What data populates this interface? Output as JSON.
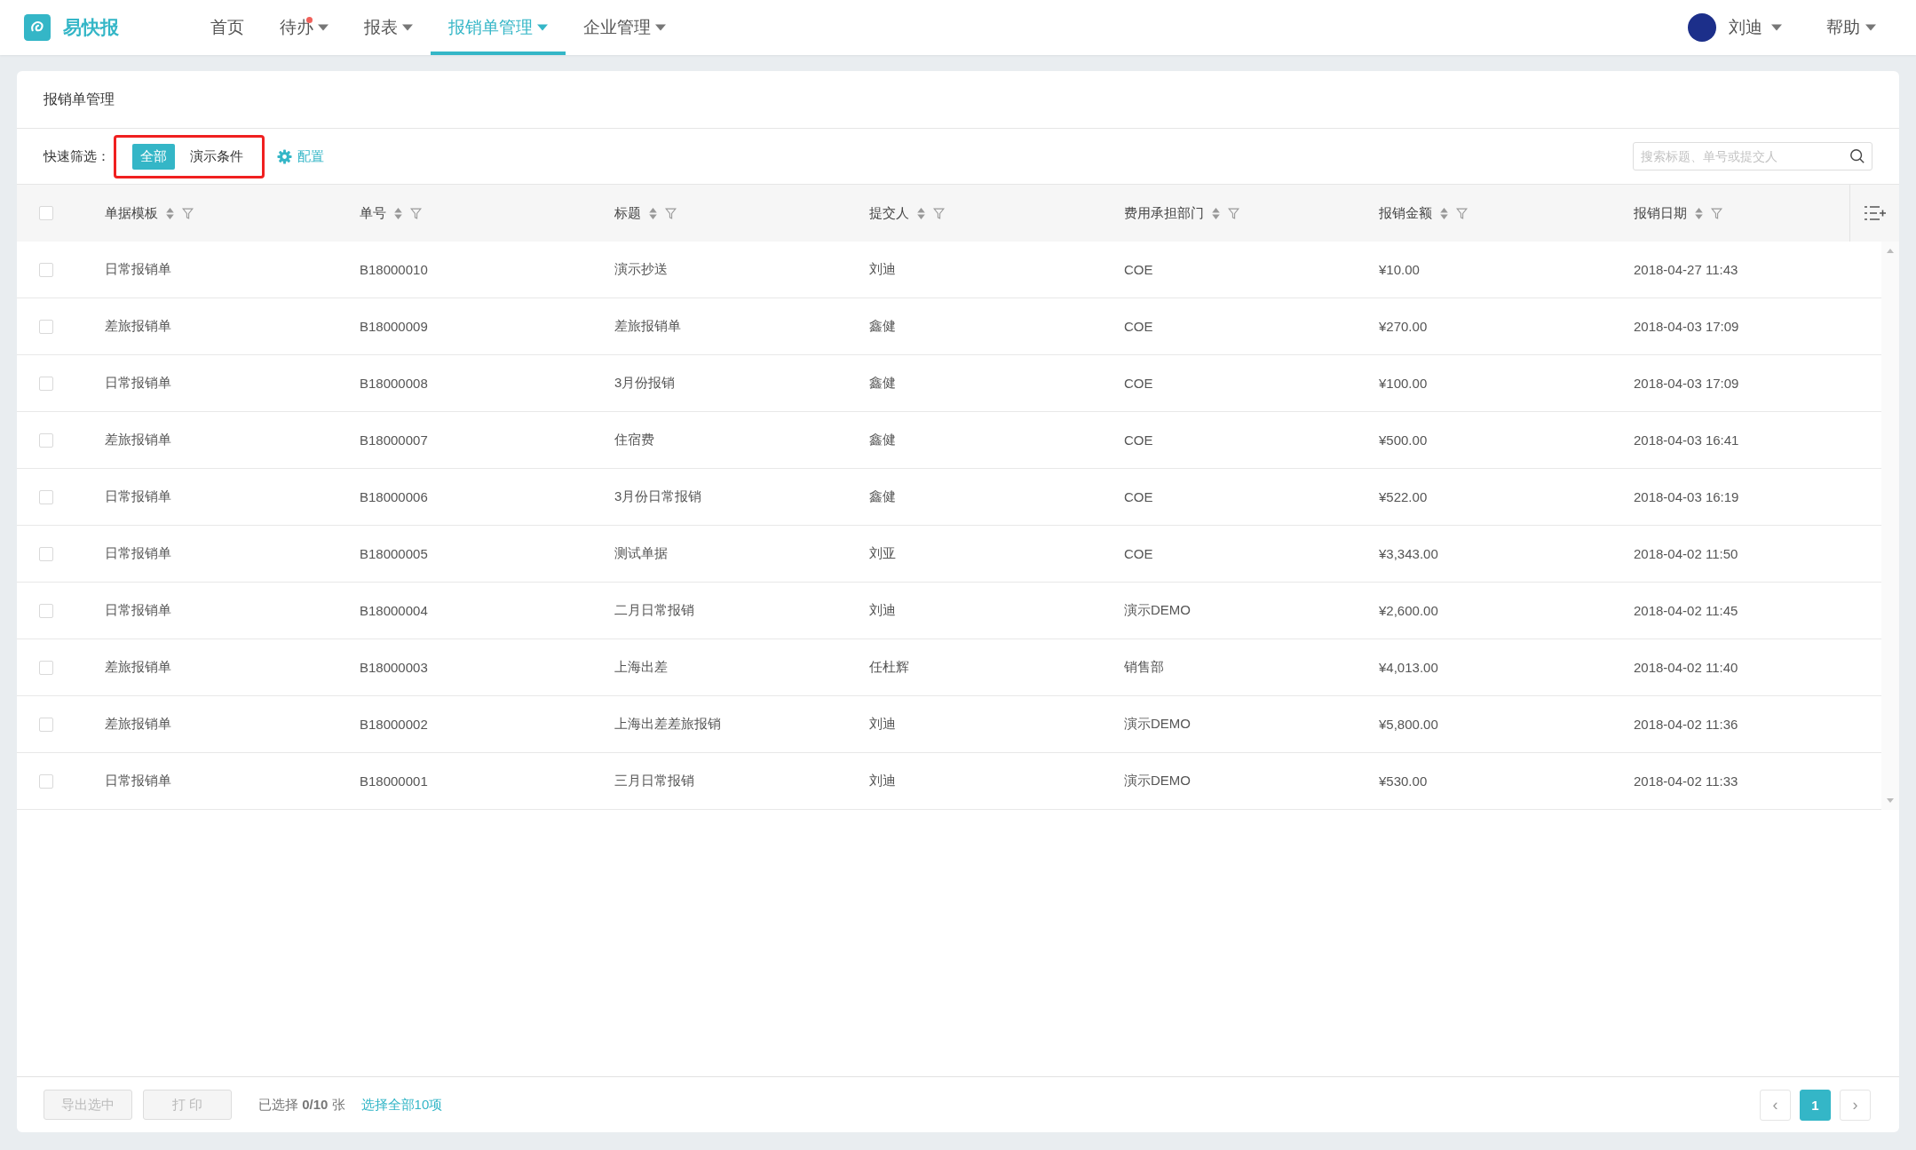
{
  "brand": {
    "name": "易快报"
  },
  "nav": [
    {
      "label": "首页",
      "selected": false,
      "dropdown": false,
      "dot": false
    },
    {
      "label": "待办",
      "selected": false,
      "dropdown": true,
      "dot": true
    },
    {
      "label": "报表",
      "selected": false,
      "dropdown": true,
      "dot": false
    },
    {
      "label": "报销单管理",
      "selected": true,
      "dropdown": true,
      "dot": false
    },
    {
      "label": "企业管理",
      "selected": false,
      "dropdown": true,
      "dot": false
    }
  ],
  "user": {
    "name": "刘迪"
  },
  "help": {
    "label": "帮助"
  },
  "page_title": "报销单管理",
  "quick_filter": {
    "label": "快速筛选：",
    "chips": [
      {
        "label": "全部",
        "selected": true
      },
      {
        "label": "演示条件",
        "selected": false
      }
    ],
    "config": "配置"
  },
  "search": {
    "placeholder": "搜索标题、单号或提交人"
  },
  "table": {
    "select_all_checked": false,
    "columns": [
      "单据模板",
      "单号",
      "标题",
      "提交人",
      "费用承担部门",
      "报销金额",
      "报销日期"
    ],
    "rows": [
      {
        "checked": false,
        "cells": [
          "日常报销单",
          "B18000010",
          "演示抄送",
          "刘迪",
          "COE",
          "¥10.00",
          "2018-04-27 11:43"
        ]
      },
      {
        "checked": false,
        "cells": [
          "差旅报销单",
          "B18000009",
          "差旅报销单",
          "鑫健",
          "COE",
          "¥270.00",
          "2018-04-03 17:09"
        ]
      },
      {
        "checked": false,
        "cells": [
          "日常报销单",
          "B18000008",
          "3月份报销",
          "鑫健",
          "COE",
          "¥100.00",
          "2018-04-03 17:09"
        ]
      },
      {
        "checked": false,
        "cells": [
          "差旅报销单",
          "B18000007",
          "住宿费",
          "鑫健",
          "COE",
          "¥500.00",
          "2018-04-03 16:41"
        ]
      },
      {
        "checked": false,
        "cells": [
          "日常报销单",
          "B18000006",
          "3月份日常报销",
          "鑫健",
          "COE",
          "¥522.00",
          "2018-04-03 16:19"
        ]
      },
      {
        "checked": false,
        "cells": [
          "日常报销单",
          "B18000005",
          "测试单据",
          "刘亚",
          "COE",
          "¥3,343.00",
          "2018-04-02 11:50"
        ]
      },
      {
        "checked": false,
        "cells": [
          "日常报销单",
          "B18000004",
          "二月日常报销",
          "刘迪",
          "演示DEMO",
          "¥2,600.00",
          "2018-04-02 11:45"
        ]
      },
      {
        "checked": false,
        "cells": [
          "差旅报销单",
          "B18000003",
          "上海出差",
          "任杜辉",
          "销售部",
          "¥4,013.00",
          "2018-04-02 11:40"
        ]
      },
      {
        "checked": false,
        "cells": [
          "差旅报销单",
          "B18000002",
          "上海出差差旅报销",
          "刘迪",
          "演示DEMO",
          "¥5,800.00",
          "2018-04-02 11:36"
        ]
      },
      {
        "checked": false,
        "cells": [
          "日常报销单",
          "B18000001",
          "三月日常报销",
          "刘迪",
          "演示DEMO",
          "¥530.00",
          "2018-04-02 11:33"
        ]
      }
    ]
  },
  "footer": {
    "buttons": [
      {
        "label": "导出选中",
        "disabled": true
      },
      {
        "label": "打 印",
        "disabled": true
      }
    ],
    "selected_prefix": "已选择",
    "selected_count": "0/10",
    "selected_suffix": "张",
    "select_all": "选择全部10项"
  },
  "pagination": {
    "prev": "‹",
    "next": "›",
    "pages": [
      {
        "label": "1",
        "selected": true
      }
    ]
  }
}
